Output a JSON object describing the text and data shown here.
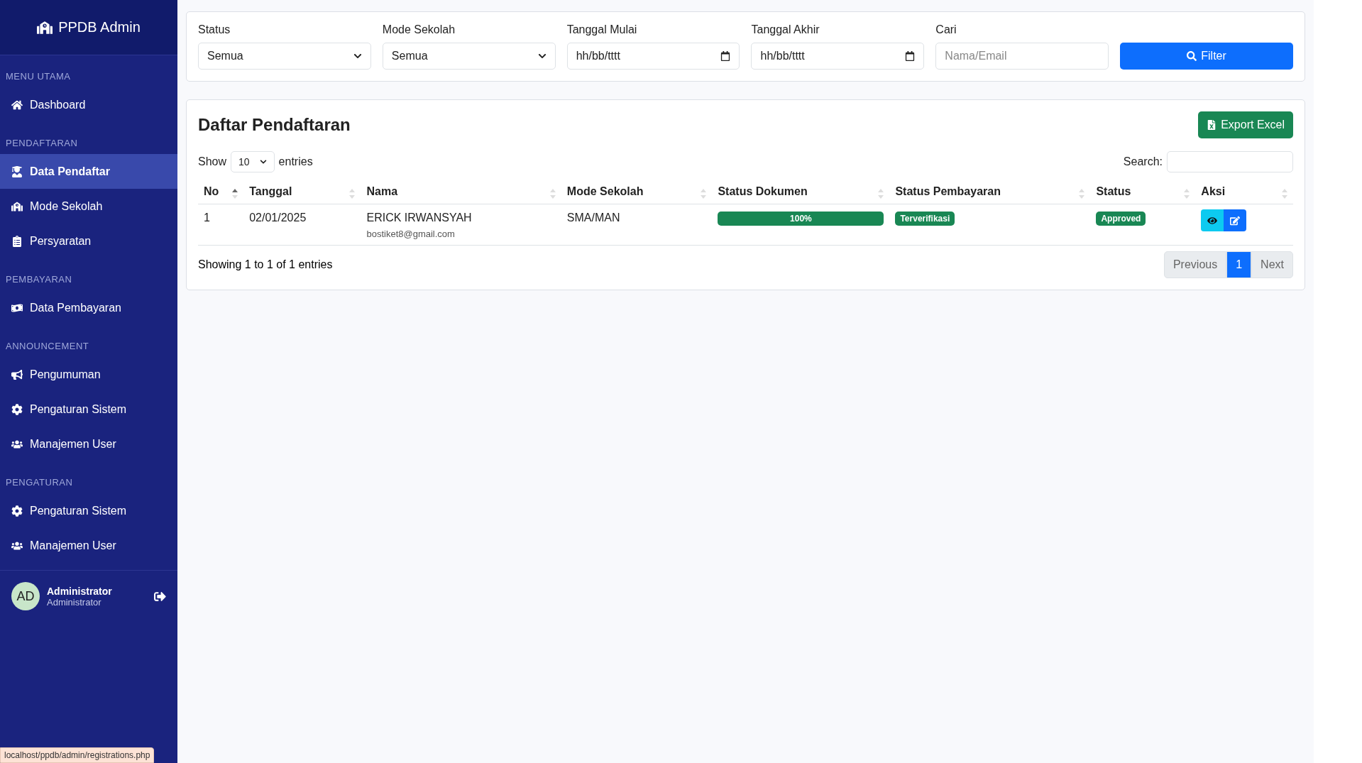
{
  "sidebar": {
    "brand": "PPDB Admin",
    "sections": [
      {
        "title": "MENU UTAMA",
        "items": [
          {
            "label": "Dashboard",
            "kind": "home",
            "selected": false
          }
        ]
      },
      {
        "title": "PENDAFTARAN",
        "items": [
          {
            "label": "Data Pendaftar",
            "kind": "student",
            "selected": true
          },
          {
            "label": "Mode Sekolah",
            "kind": "school",
            "selected": false
          },
          {
            "label": "Persyaratan",
            "kind": "clipboard",
            "selected": false
          }
        ]
      },
      {
        "title": "PEMBAYARAN",
        "items": [
          {
            "label": "Data Pembayaran",
            "kind": "money",
            "selected": false
          }
        ]
      },
      {
        "title": "ANNOUNCEMENT",
        "items": [
          {
            "label": "Pengumuman",
            "kind": "megaphone",
            "selected": false
          },
          {
            "label": "Pengaturan Sistem",
            "kind": "gear",
            "selected": false
          },
          {
            "label": "Manajemen User",
            "kind": "users",
            "selected": false
          }
        ]
      },
      {
        "title": "PENGATURAN",
        "items": [
          {
            "label": "Pengaturan Sistem",
            "kind": "gear",
            "selected": false
          },
          {
            "label": "Manajemen User",
            "kind": "users",
            "selected": false
          }
        ]
      }
    ],
    "user": {
      "initials": "AD",
      "name": "Administrator",
      "role": "Administrator"
    }
  },
  "filters": {
    "fields": [
      {
        "kind": "select",
        "label": "Status",
        "value": "Semua"
      },
      {
        "kind": "select",
        "label": "Mode Sekolah",
        "value": "Semua"
      },
      {
        "kind": "date",
        "label": "Tanggal Mulai",
        "value": "hh/bb/tttt"
      },
      {
        "kind": "date",
        "label": "Tanggal Akhir",
        "value": "hh/bb/tttt"
      },
      {
        "kind": "text",
        "label": "Cari",
        "placeholder": "Nama/Email"
      }
    ],
    "button": "Filter"
  },
  "table_card": {
    "title": "Daftar Pendaftaran",
    "export_button": "Export Excel",
    "show_label": "Show",
    "page_size": "10",
    "entries_label": "entries",
    "search_label": "Search:",
    "columns": [
      {
        "label": "No",
        "sorted": true
      },
      {
        "label": "Tanggal",
        "sorted": false
      },
      {
        "label": "Nama",
        "sorted": false
      },
      {
        "label": "Mode Sekolah",
        "sorted": false
      },
      {
        "label": "Status Dokumen",
        "sorted": false
      },
      {
        "label": "Status Pembayaran",
        "sorted": false
      },
      {
        "label": "Status",
        "sorted": false
      },
      {
        "label": "Aksi",
        "sorted": false
      }
    ],
    "rows": [
      {
        "no": "1",
        "date": "02/01/2025",
        "name": "ERICK IRWANSYAH",
        "email": "bostiket8@gmail.com",
        "mode": "SMA/MAN",
        "doc_progress": {
          "level": 1,
          "label": "100%"
        },
        "payment_status": "Terverifikasi",
        "status": "Approved"
      }
    ],
    "info": "Showing 1 to 1 of 1 entries",
    "pagination": [
      {
        "label": "Previous",
        "selected": false
      },
      {
        "label": "1",
        "selected": true
      },
      {
        "label": "Next",
        "selected": false
      }
    ]
  },
  "status_url": "localhost/ppdb/admin/registrations.php"
}
